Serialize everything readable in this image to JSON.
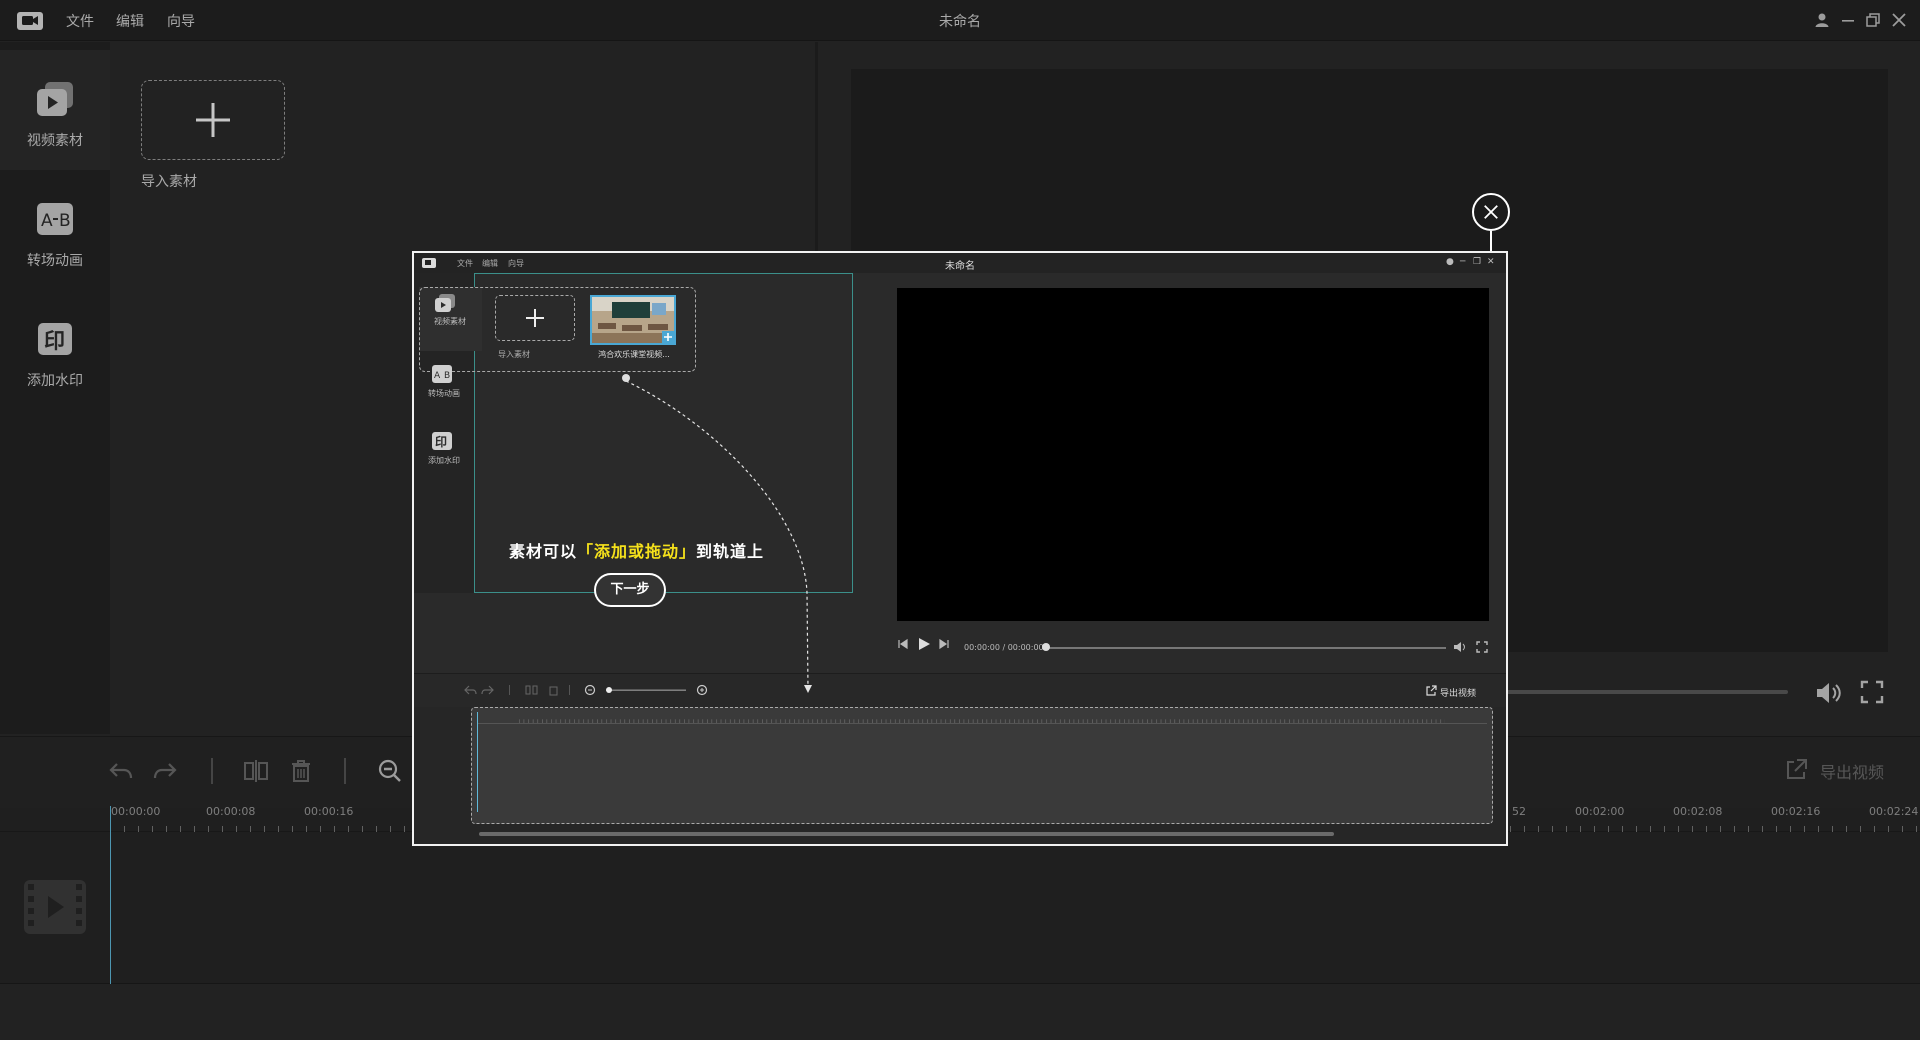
{
  "app": {
    "title": "未命名"
  },
  "menu": {
    "file": "文件",
    "edit": "编辑",
    "wizard": "向导"
  },
  "nav": {
    "items": [
      {
        "label": "视频素材",
        "icon": "video-library-icon"
      },
      {
        "label": "转场动画",
        "icon": "transition-ab-icon"
      },
      {
        "label": "添加水印",
        "icon": "watermark-stamp-icon"
      }
    ]
  },
  "media": {
    "import_label": "导入素材"
  },
  "toolbar": {
    "export_label": "导出视频"
  },
  "timeline": {
    "ticks": [
      "00:00:00",
      "00:00:08",
      "00:00:16",
      "00:02:00",
      "00:02:08",
      "00:02:16",
      "00:02:24"
    ],
    "partial_tick": "52"
  },
  "guide": {
    "mini_title": "未命名",
    "mini_menu": {
      "file": "文件",
      "edit": "编辑",
      "wizard": "向导"
    },
    "mini_nav": [
      "视频素材",
      "转场动画",
      "添加水印"
    ],
    "mini_import_label": "导入素材",
    "mini_thumb_label": "鸿合欢乐课堂视频...",
    "mini_time": "00:00:00 / 00:00:00",
    "mini_export_label": "导出视频",
    "hint_prefix": "素材可以",
    "hint_highlight": "「添加或拖动」",
    "hint_suffix": "到轨道上",
    "next_label": "下一步"
  },
  "colors": {
    "accent": "#5fb8d8",
    "highlight_text": "#f5e11b",
    "panel_border": "#3b8f8a"
  }
}
